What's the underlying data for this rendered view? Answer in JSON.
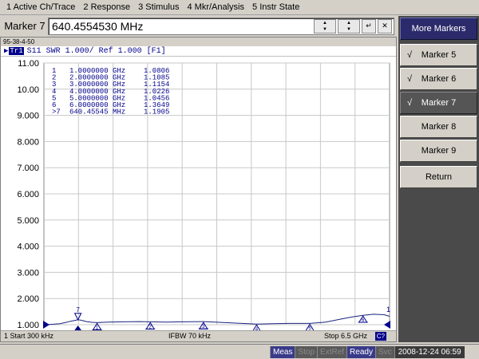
{
  "menu": [
    {
      "label": "1 Active Ch/Trace"
    },
    {
      "label": "2 Response"
    },
    {
      "label": "3 Stimulus"
    },
    {
      "label": "4 Mkr/Analysis"
    },
    {
      "label": "5 Instr State"
    }
  ],
  "entry": {
    "label": "Marker 7",
    "value": "640.4554530 MHz",
    "spin_up_icon": "up-arrow",
    "spin_down_icon": "down-arrow",
    "enter_icon": "enter-icon",
    "close_icon": "close-icon"
  },
  "chart_window": {
    "titlebar": "95-38-4-50",
    "trace_tag": "Tr1",
    "trace_header": "S11  SWR 1.000/ Ref 1.000 [F1]",
    "footer_start": "1  Start 300 kHz",
    "footer_ifbw": "IFBW 70 kHz",
    "footer_stop": "Stop 6.5 GHz",
    "footer_c": "C?"
  },
  "markers_table": [
    {
      "num": "1",
      "freq": "1.0000000 GHz",
      "val": "1.0806"
    },
    {
      "num": "2",
      "freq": "2.0000000 GHz",
      "val": "1.1085"
    },
    {
      "num": "3",
      "freq": "3.0000000 GHz",
      "val": "1.1154"
    },
    {
      "num": "4",
      "freq": "4.0000000 GHz",
      "val": "1.0226"
    },
    {
      "num": "5",
      "freq": "5.0000000 GHz",
      "val": "1.0456"
    },
    {
      "num": "6",
      "freq": "6.0000000 GHz",
      "val": "1.3649"
    },
    {
      "num": ">7",
      "freq": "640.45545 MHz",
      "val": "1.1905"
    }
  ],
  "softkeys": {
    "title": "More Markers",
    "items": [
      {
        "label": "Marker 5",
        "checked": true
      },
      {
        "label": "Marker 6",
        "checked": true
      },
      {
        "label": "Marker 7",
        "checked": true,
        "selected": true
      },
      {
        "label": "Marker 8",
        "checked": false
      },
      {
        "label": "Marker 9",
        "checked": false
      }
    ],
    "return_label": "Return",
    "check_glyph": "√"
  },
  "status": {
    "meas": "Meas",
    "stop": "Stop",
    "extref": "ExtRef",
    "ready": "Ready",
    "svc": "Svc",
    "datetime": "2008-12-24 06:59"
  },
  "colors": {
    "trace": "#1a237e",
    "grid": "#c8c8c8",
    "axis_text": "#000000",
    "active_marker": "#00008b"
  },
  "chart_data": {
    "type": "line",
    "title": "",
    "xlabel": "",
    "ylabel": "",
    "x_unit": "GHz",
    "xlim": [
      0.0003,
      6.5
    ],
    "ylim": [
      1.0,
      11.0
    ],
    "y_ticks": [
      "11.00",
      "10.00",
      "9.000",
      "8.000",
      "7.000",
      "6.000",
      "5.000",
      "4.000",
      "3.000",
      "2.000",
      "1.000"
    ],
    "grid": true,
    "series": [
      {
        "x": [
          0.0003,
          0.1,
          0.2,
          0.3,
          0.4,
          0.5,
          0.6,
          0.64,
          0.7,
          0.8,
          0.9,
          1.0,
          1.2,
          1.5,
          1.8,
          2.0,
          2.3,
          2.6,
          3.0,
          3.3,
          3.6,
          4.0,
          4.3,
          4.6,
          5.0,
          5.3,
          5.6,
          5.8,
          6.0,
          6.2,
          6.4,
          6.5
        ],
        "values": [
          1.0,
          1.01,
          1.02,
          1.04,
          1.08,
          1.13,
          1.17,
          1.19,
          1.17,
          1.12,
          1.09,
          1.08,
          1.1,
          1.11,
          1.12,
          1.11,
          1.1,
          1.11,
          1.12,
          1.09,
          1.06,
          1.02,
          1.04,
          1.05,
          1.05,
          1.1,
          1.22,
          1.3,
          1.36,
          1.4,
          1.38,
          1.32
        ]
      }
    ],
    "markers": [
      {
        "id": "1",
        "x": 1.0,
        "y": 1.0806
      },
      {
        "id": "2",
        "x": 2.0,
        "y": 1.1085
      },
      {
        "id": "3",
        "x": 3.0,
        "y": 1.1154
      },
      {
        "id": "4",
        "x": 4.0,
        "y": 1.0226
      },
      {
        "id": "5",
        "x": 5.0,
        "y": 1.0456
      },
      {
        "id": "6",
        "x": 6.0,
        "y": 1.3649
      },
      {
        "id": "7",
        "x": 0.64045545,
        "y": 1.1905,
        "active": true
      }
    ],
    "ref_line_label": "1"
  }
}
